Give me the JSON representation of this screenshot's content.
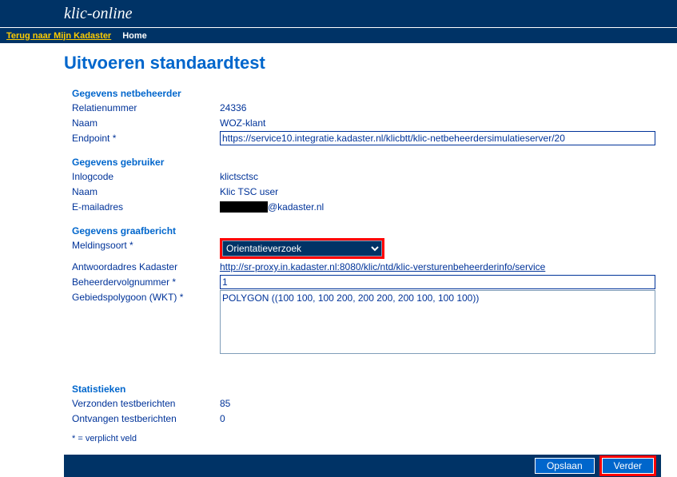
{
  "header": {
    "brand": "klic-online",
    "back_link": "Terug naar Mijn Kadaster",
    "home_link": "Home"
  },
  "title": "Uitvoeren standaardtest",
  "netbeheerder": {
    "section": "Gegevens netbeheerder",
    "relatienummer_label": "Relatienummer",
    "relatienummer_value": "24336",
    "naam_label": "Naam",
    "naam_value": "WOZ-klant",
    "endpoint_label": "Endpoint *",
    "endpoint_value": "https://service10.integratie.kadaster.nl/klicbtt/klic-netbeheerdersimulatieserver/20"
  },
  "gebruiker": {
    "section": "Gegevens gebruiker",
    "inlogcode_label": "Inlogcode",
    "inlogcode_value": "klictsctsc",
    "naam_label": "Naam",
    "naam_value": "Klic TSC user",
    "email_label": "E-mailadres",
    "email_value_suffix": "@kadaster.nl"
  },
  "graafbericht": {
    "section": "Gegevens graafbericht",
    "meldingsoort_label": "Meldingsoort *",
    "meldingsoort_value": "Orientatieverzoek",
    "antwoordadres_label": "Antwoordadres Kadaster",
    "antwoordadres_value": "http://sr-proxy.in.kadaster.nl:8080/klic/ntd/klic-versturenbeheerderinfo/service",
    "beheerdervolgnummer_label": "Beheerdervolgnummer *",
    "beheerdervolgnummer_value": "1",
    "gebiedspolygoon_label": "Gebiedspolygoon (WKT) *",
    "gebiedspolygoon_value": "POLYGON ((100 100, 100 200, 200 200, 200 100, 100 100))"
  },
  "statistieken": {
    "section": "Statistieken",
    "verzonden_label": "Verzonden testberichten",
    "verzonden_value": "85",
    "ontvangen_label": "Ontvangen testberichten",
    "ontvangen_value": "0"
  },
  "note": "* = verplicht veld",
  "buttons": {
    "opslaan": "Opslaan",
    "verder": "Verder"
  }
}
